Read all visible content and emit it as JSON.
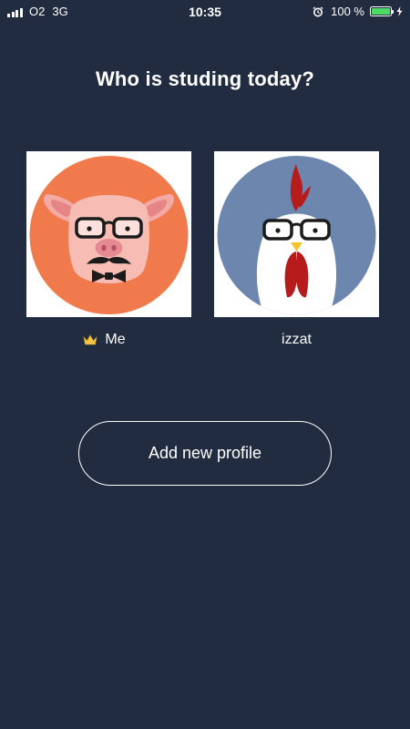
{
  "status_bar": {
    "carrier": "O2",
    "network": "3G",
    "time": "10:35",
    "battery_percent": "100 %",
    "battery_color": "#4cd964",
    "icons": [
      "signal-icon",
      "alarm-icon",
      "battery-icon",
      "charging-bolt-icon"
    ]
  },
  "title": "Who is studing today?",
  "profiles": [
    {
      "name": "Me",
      "avatar": "pig-with-glasses-and-bowtie",
      "badge": "crown-icon",
      "avatar_bg": "#f07a4c"
    },
    {
      "name": "izzat",
      "avatar": "rooster-with-glasses",
      "badge": "",
      "avatar_bg": "#6d86ad"
    }
  ],
  "add_profile_label": "Add new profile",
  "colors": {
    "background": "#222c40",
    "text": "#ffffff"
  }
}
